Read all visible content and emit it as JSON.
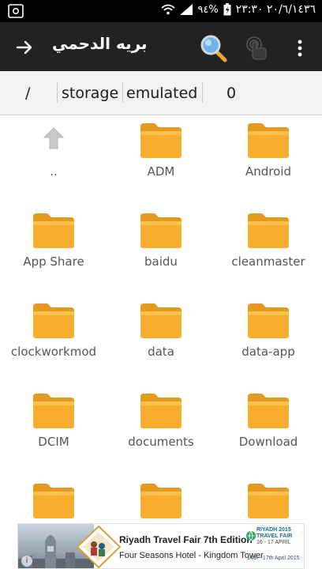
{
  "status_bar": {
    "battery": "٩٤%",
    "datetime": "٢٠/٦/١٤٣٦ ٢٣:٣٠"
  },
  "action_bar": {
    "title": "بريه الدحمي",
    "icons": [
      "arrow-right-icon",
      "search-icon",
      "touch-icon",
      "overflow-menu-icon"
    ]
  },
  "path": {
    "crumbs": [
      "/",
      "storage",
      "emulated",
      "0"
    ]
  },
  "files": [
    {
      "name": "..",
      "icon": "parent-up-icon"
    },
    {
      "name": "ADM",
      "icon": "folder-icon"
    },
    {
      "name": "Android",
      "icon": "folder-icon"
    },
    {
      "name": "App Share",
      "icon": "folder-icon"
    },
    {
      "name": "baidu",
      "icon": "folder-icon"
    },
    {
      "name": "cleanmaster",
      "icon": "folder-icon"
    },
    {
      "name": "clockworkmod",
      "icon": "folder-icon"
    },
    {
      "name": "data",
      "icon": "folder-icon"
    },
    {
      "name": "data-app",
      "icon": "folder-icon"
    },
    {
      "name": "DCIM",
      "icon": "folder-icon"
    },
    {
      "name": "documents",
      "icon": "folder-icon"
    },
    {
      "name": "Download",
      "icon": "folder-icon"
    },
    {
      "name": "",
      "icon": "folder-icon"
    },
    {
      "name": "",
      "icon": "folder-icon"
    },
    {
      "name": "",
      "icon": "folder-icon"
    }
  ],
  "ad": {
    "title": "Riyadh Travel Fair 7th Edition",
    "subtitle": "Four Seasons Hotel - Kingdom Tower",
    "brand": "RIYADH 2015 TRAVEL FAIR",
    "brand_dates": "16 - 17 APRIL",
    "date": "14th - 17th April 2015"
  },
  "colors": {
    "action_bar": "#222222",
    "status_bar": "#000000",
    "path_bar": "#f2f2f2",
    "folder": "#f5a623",
    "label": "#555555"
  }
}
